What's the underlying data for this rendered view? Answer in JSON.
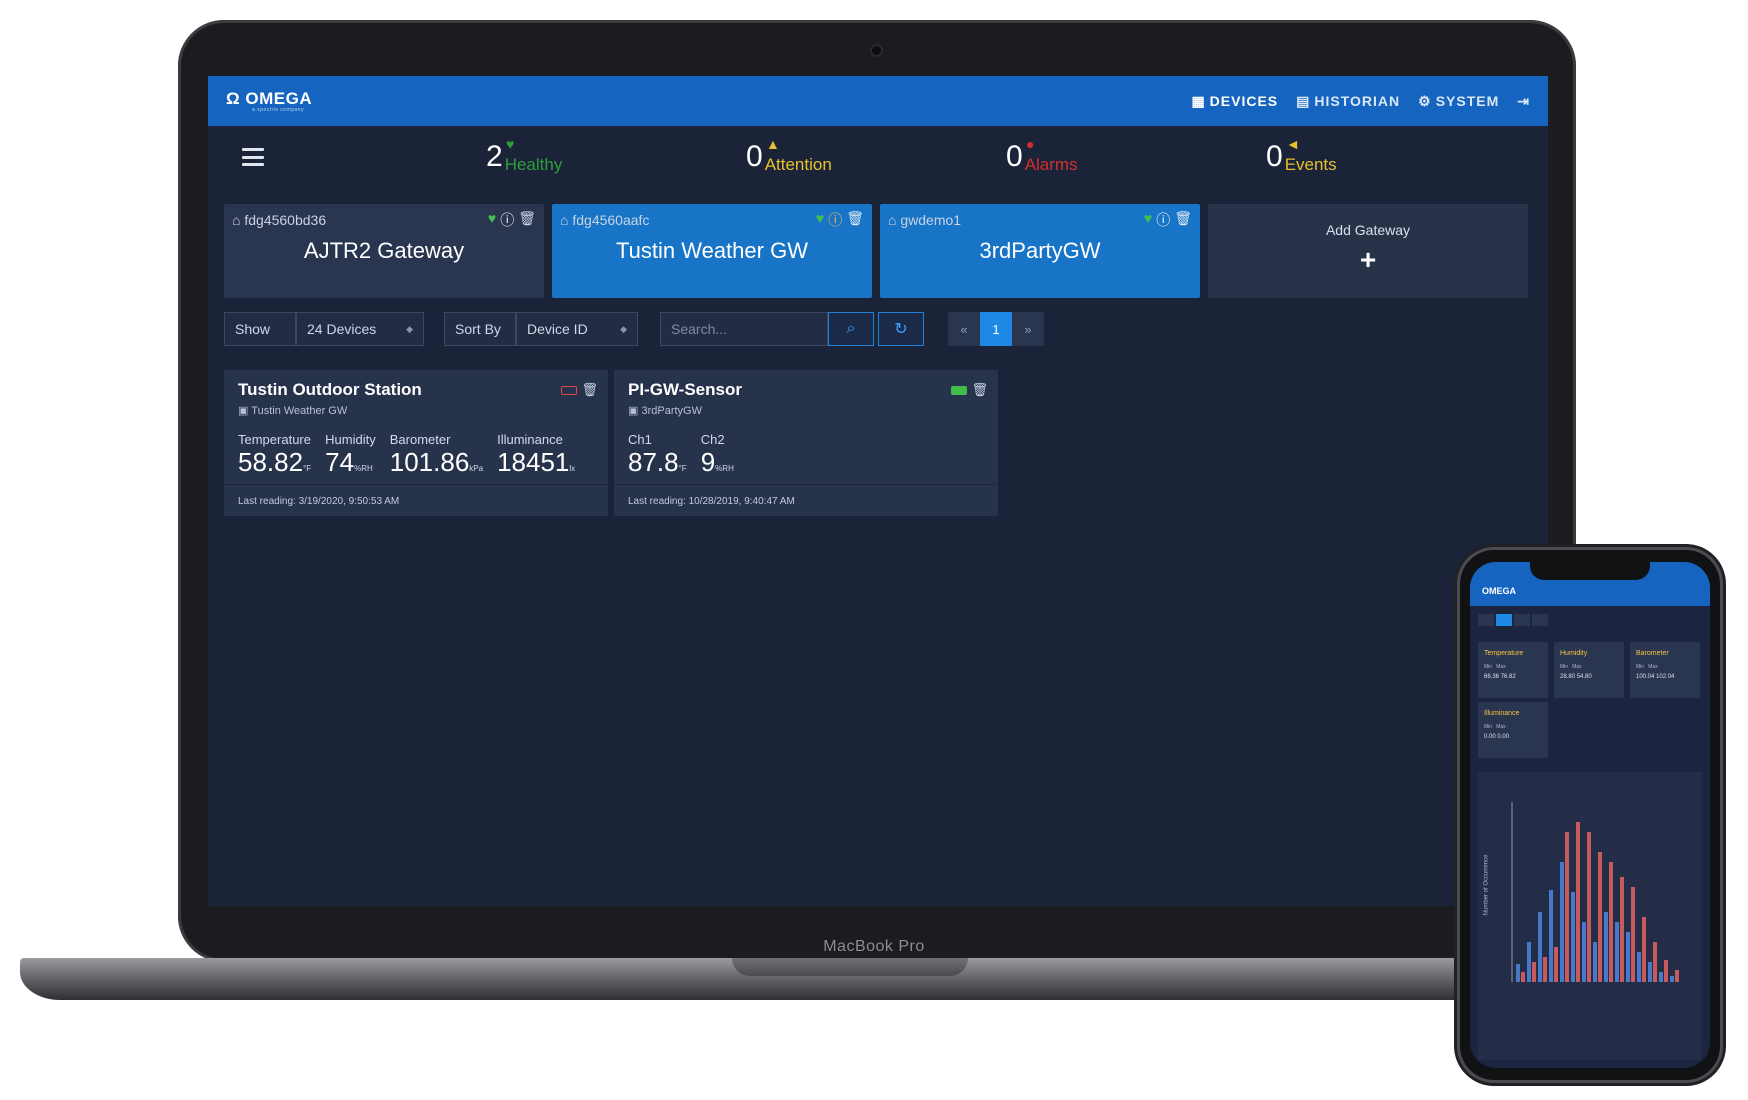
{
  "header": {
    "logo": "OMEGA",
    "logo_sub": "a spectris company",
    "nav": [
      {
        "icon": "grid-icon",
        "label": "DEVICES"
      },
      {
        "icon": "database-icon",
        "label": "HISTORIAN"
      },
      {
        "icon": "gears-icon",
        "label": "SYSTEM"
      }
    ]
  },
  "status": [
    {
      "count": "2",
      "label": "Healthy",
      "color": "#2e9e3a",
      "icon": "heart-icon"
    },
    {
      "count": "0",
      "label": "Attention",
      "color": "#e7c02d",
      "icon": "warning-icon"
    },
    {
      "count": "0",
      "label": "Alarms",
      "color": "#d32f2f",
      "icon": "bell-icon"
    },
    {
      "count": "0",
      "label": "Events",
      "color": "#e7c02d",
      "icon": "megaphone-icon"
    }
  ],
  "gateways": [
    {
      "id": "fdg4560bd36",
      "name": "AJTR2 Gateway"
    },
    {
      "id": "fdg4560aafc",
      "name": "Tustin Weather GW"
    },
    {
      "id": "gwdemo1",
      "name": "3rdPartyGW"
    }
  ],
  "add_gateway": {
    "label": "Add Gateway",
    "icon": "+"
  },
  "toolbar": {
    "show_label": "Show",
    "show_value": "24 Devices",
    "sort_label": "Sort By",
    "sort_value": "Device ID",
    "search_placeholder": "Search...",
    "page_prev": "«",
    "page_current": "1",
    "page_next": "»"
  },
  "devices": [
    {
      "title": "Tustin Outdoor Station",
      "gateway": "Tustin Weather GW",
      "metrics": [
        {
          "label": "Temperature",
          "value": "58.82",
          "unit": "°F"
        },
        {
          "label": "Humidity",
          "value": "74",
          "unit": "%RH"
        },
        {
          "label": "Barometer",
          "value": "101.86",
          "unit": "kPa"
        },
        {
          "label": "Illuminance",
          "value": "18451",
          "unit": "lx"
        }
      ],
      "last": "Last reading: 3/19/2020, 9:50:53 AM"
    },
    {
      "title": "PI-GW-Sensor",
      "gateway": "3rdPartyGW",
      "metrics": [
        {
          "label": "Ch1",
          "value": "87.8",
          "unit": "°F"
        },
        {
          "label": "Ch2",
          "value": "9",
          "unit": "%RH"
        }
      ],
      "last": "Last reading: 10/28/2019, 9:40:47 AM"
    }
  ],
  "laptop_label": "MacBook Pro",
  "phone": {
    "logo": "OMEGA",
    "boxes": [
      {
        "title": "Temperature",
        "min": "66.36",
        "max": "76.82"
      },
      {
        "title": "Humidity",
        "min": "28.80",
        "max": "54.80"
      },
      {
        "title": "Barometer",
        "min": "100.04",
        "max": "102.04"
      },
      {
        "title": "Illuminance",
        "min": "0.00",
        "max": "0.00"
      }
    ],
    "chart_ylabel": "Number of Occurrence"
  },
  "colors": {
    "header": "#1565c0",
    "selected_gateway": "#1774c6",
    "background": "#1a2338"
  }
}
